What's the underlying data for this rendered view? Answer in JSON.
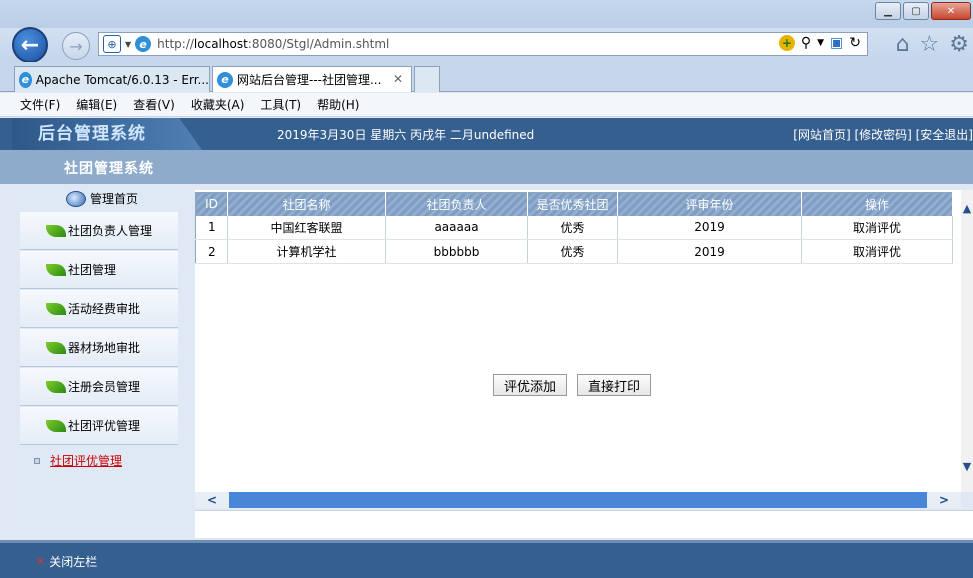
{
  "browser": {
    "url_prefix": "http://",
    "url_host": "localhost",
    "url_rest": ":8080/Stgl/Admin.shtml",
    "tabs": [
      {
        "label": "Apache Tomcat/6.0.13 - Err..."
      },
      {
        "label": "网站后台管理---社团管理..."
      }
    ],
    "menu": [
      "文件(F)",
      "编辑(E)",
      "查看(V)",
      "收藏夹(A)",
      "工具(T)",
      "帮助(H)"
    ]
  },
  "header": {
    "logo": "后台管理系统",
    "date_text": "2019年3月30日 星期六 丙戌年 二月undefined",
    "links": "[网站首页] [修改密码] [安全退出]"
  },
  "subheader": {
    "title": "社团管理系统"
  },
  "sidebar": {
    "home": "管理首页",
    "items": [
      {
        "label": "社团负责人管理"
      },
      {
        "label": "社团管理"
      },
      {
        "label": "活动经费审批"
      },
      {
        "label": "器材场地审批"
      },
      {
        "label": "注册会员管理"
      },
      {
        "label": "社团评优管理"
      }
    ],
    "sub_link": "社团评优管理"
  },
  "table": {
    "headers": [
      "ID",
      "社团名称",
      "社团负责人",
      "是否优秀社团",
      "评审年份",
      "操作"
    ],
    "rows": [
      [
        "1",
        "中国红客联盟",
        "aaaaaa",
        "优秀",
        "2019",
        "取消评优"
      ],
      [
        "2",
        "计算机学社",
        "bbbbbb",
        "优秀",
        "2019",
        "取消评优"
      ]
    ]
  },
  "buttons": {
    "add": "评优添加",
    "print": "直接打印"
  },
  "footer": {
    "close_left": "关闭左栏"
  },
  "colors": {
    "header_blue": "#355f8f",
    "table_header": "#8eabcb",
    "link_red": "#cc0000"
  }
}
